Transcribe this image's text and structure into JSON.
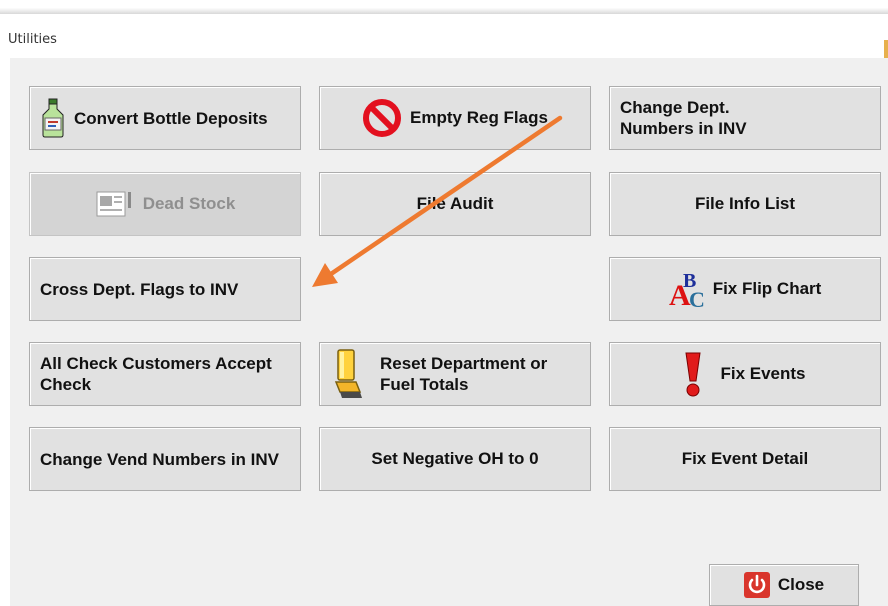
{
  "window": {
    "title": "Utilities"
  },
  "buttons": {
    "convert_bottle_deposits": "Convert Bottle Deposits",
    "empty_reg_flags": "Empty Reg Flags",
    "change_dept_numbers": "Change Dept. Numbers in INV",
    "dead_stock": "Dead Stock",
    "file_audit": "File Audit",
    "file_info_list": "File Info List",
    "cross_dept_flags": "Cross Dept. Flags to INV",
    "fix_flip_chart": "Fix Flip Chart",
    "all_check_customers": "All Check Customers Accept Check",
    "reset_department": "Reset Department or Fuel Totals",
    "fix_events": "Fix Events",
    "change_vend_numbers": "Change Vend Numbers in INV",
    "set_negative_oh": "Set Negative OH to 0",
    "fix_event_detail": "Fix Event Detail",
    "close": "Close"
  },
  "icons": {
    "convert_bottle_deposits": "bottle-icon",
    "empty_reg_flags": "no-entry-icon",
    "dead_stock": "document-icon",
    "fix_flip_chart": "spelling-abc-icon",
    "reset_department": "reset-lever-icon",
    "fix_events": "exclamation-icon",
    "close": "power-icon"
  },
  "annotation": {
    "color": "#ee7a30"
  }
}
